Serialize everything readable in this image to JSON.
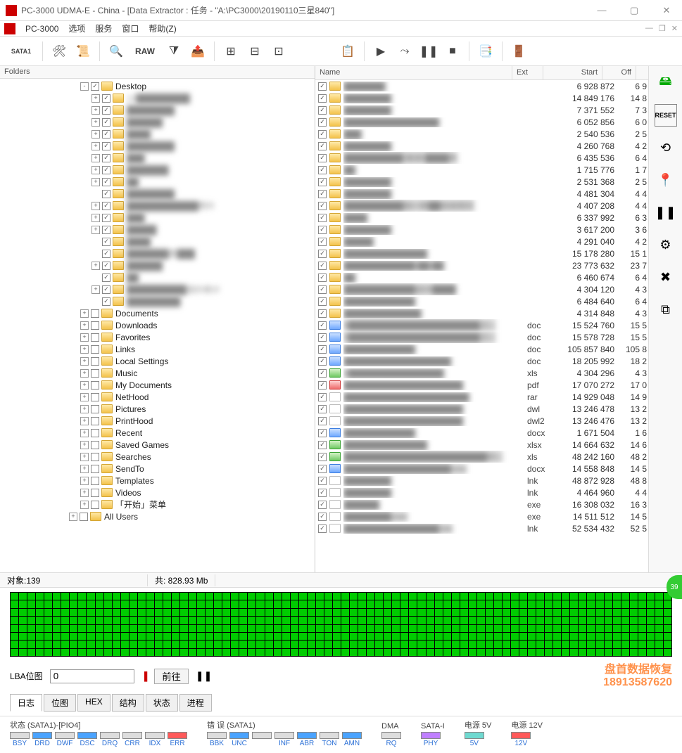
{
  "window": {
    "title": "PC-3000 UDMA-E - China - [Data Extractor : 任务 - \"A:\\PC3000\\20190110三星840\"]",
    "app_name": "PC-3000"
  },
  "menu": {
    "items": [
      "PC-3000",
      "选项",
      "服务",
      "窗口",
      "帮助(Z)"
    ]
  },
  "toolbar": {
    "sata": "SATA1",
    "raw": "RAW"
  },
  "left_panel": {
    "header": "Folders"
  },
  "tree": [
    {
      "indent": 7,
      "exp": "-",
      "chk": true,
      "label": "Desktop"
    },
    {
      "indent": 8,
      "exp": "+",
      "chk": true,
      "label": "12█████████",
      "blur": true
    },
    {
      "indent": 8,
      "exp": "+",
      "chk": true,
      "label": "████████",
      "blur": true
    },
    {
      "indent": 8,
      "exp": "+",
      "chk": true,
      "label": "██████",
      "blur": true
    },
    {
      "indent": 8,
      "exp": "+",
      "chk": true,
      "label": "████",
      "blur": true
    },
    {
      "indent": 8,
      "exp": "+",
      "chk": true,
      "label": "████████",
      "blur": true
    },
    {
      "indent": 8,
      "exp": "+",
      "chk": true,
      "label": "███",
      "blur": true
    },
    {
      "indent": 8,
      "exp": "+",
      "chk": true,
      "label": "███████",
      "blur": true
    },
    {
      "indent": 8,
      "exp": "+",
      "chk": true,
      "label": "██",
      "blur": true
    },
    {
      "indent": 8,
      "exp": "",
      "chk": true,
      "label": "████████",
      "blur": true
    },
    {
      "indent": 8,
      "exp": "+",
      "chk": true,
      "label": "████████████照片",
      "blur": true
    },
    {
      "indent": 8,
      "exp": "+",
      "chk": true,
      "label": "███",
      "blur": true
    },
    {
      "indent": 8,
      "exp": "+",
      "chk": true,
      "label": "█████",
      "blur": true
    },
    {
      "indent": 8,
      "exp": "",
      "chk": true,
      "label": "████",
      "blur": true
    },
    {
      "indent": 8,
      "exp": "",
      "chk": true,
      "label": "███████图███",
      "blur": true
    },
    {
      "indent": 8,
      "exp": "+",
      "chk": true,
      "label": "██████",
      "blur": true
    },
    {
      "indent": 8,
      "exp": "",
      "chk": true,
      "label": "██",
      "blur": true
    },
    {
      "indent": 8,
      "exp": "+",
      "chk": true,
      "label": "██████████造价统计",
      "blur": true
    },
    {
      "indent": 8,
      "exp": "",
      "chk": true,
      "label": "█████████",
      "blur": true
    },
    {
      "indent": 7,
      "exp": "+",
      "chk": false,
      "label": "Documents"
    },
    {
      "indent": 7,
      "exp": "+",
      "chk": false,
      "label": "Downloads"
    },
    {
      "indent": 7,
      "exp": "+",
      "chk": false,
      "label": "Favorites"
    },
    {
      "indent": 7,
      "exp": "+",
      "chk": false,
      "label": "Links"
    },
    {
      "indent": 7,
      "exp": "+",
      "chk": false,
      "label": "Local Settings"
    },
    {
      "indent": 7,
      "exp": "+",
      "chk": false,
      "label": "Music"
    },
    {
      "indent": 7,
      "exp": "+",
      "chk": false,
      "label": "My Documents"
    },
    {
      "indent": 7,
      "exp": "+",
      "chk": false,
      "label": "NetHood"
    },
    {
      "indent": 7,
      "exp": "+",
      "chk": false,
      "label": "Pictures"
    },
    {
      "indent": 7,
      "exp": "+",
      "chk": false,
      "label": "PrintHood"
    },
    {
      "indent": 7,
      "exp": "+",
      "chk": false,
      "label": "Recent"
    },
    {
      "indent": 7,
      "exp": "+",
      "chk": false,
      "label": "Saved Games"
    },
    {
      "indent": 7,
      "exp": "+",
      "chk": false,
      "label": "Searches"
    },
    {
      "indent": 7,
      "exp": "+",
      "chk": false,
      "label": "SendTo"
    },
    {
      "indent": 7,
      "exp": "+",
      "chk": false,
      "label": "Templates"
    },
    {
      "indent": 7,
      "exp": "+",
      "chk": false,
      "label": "Videos"
    },
    {
      "indent": 7,
      "exp": "+",
      "chk": false,
      "label": "「开始」菜单"
    },
    {
      "indent": 6,
      "exp": "+",
      "chk": false,
      "label": "All Users"
    }
  ],
  "filelist": {
    "columns": {
      "name": "Name",
      "ext": "Ext",
      "start": "Start",
      "off": "Off"
    },
    "rows": [
      {
        "chk": true,
        "icon": "folder",
        "name": "███████",
        "ext": "",
        "start": "6 928 872",
        "off": "6 9"
      },
      {
        "chk": true,
        "icon": "folder",
        "name": "████████",
        "ext": "",
        "start": "14 849 176",
        "off": "14 8"
      },
      {
        "chk": true,
        "icon": "folder",
        "name": "████████",
        "ext": "",
        "start": "7 371 552",
        "off": "7 3"
      },
      {
        "chk": true,
        "icon": "folder",
        "name": "████████████████",
        "ext": "",
        "start": "6 052 856",
        "off": "6 0"
      },
      {
        "chk": true,
        "icon": "folder",
        "name": "███",
        "ext": "",
        "start": "2 540 536",
        "off": "2 5"
      },
      {
        "chk": true,
        "icon": "folder",
        "name": "████████",
        "ext": "",
        "start": "4 260 768",
        "off": "4 2"
      },
      {
        "chk": true,
        "icon": "folder",
        "name": "██████████ 案源 ████件",
        "ext": "",
        "start": "6 435 536",
        "off": "6 4"
      },
      {
        "chk": true,
        "icon": "folder",
        "name": "██",
        "ext": "",
        "start": "1 715 776",
        "off": "1 7"
      },
      {
        "chk": true,
        "icon": "folder",
        "name": "████████",
        "ext": "",
        "start": "2 531 368",
        "off": "2 5"
      },
      {
        "chk": true,
        "icon": "folder",
        "name": "████████",
        "ext": "",
        "start": "4 481 304",
        "off": "4 4"
      },
      {
        "chk": true,
        "icon": "folder",
        "name": "██████████园一期██验收照片",
        "ext": "",
        "start": "4 407 208",
        "off": "4 4"
      },
      {
        "chk": true,
        "icon": "folder",
        "name": "████",
        "ext": "",
        "start": "6 337 992",
        "off": "6 3"
      },
      {
        "chk": true,
        "icon": "folder",
        "name": "████████",
        "ext": "",
        "start": "3 617 200",
        "off": "3 6"
      },
      {
        "chk": true,
        "icon": "folder",
        "name": "█████",
        "ext": "",
        "start": "4 291 040",
        "off": "4 2"
      },
      {
        "chk": true,
        "icon": "folder",
        "name": "██████████████",
        "ext": "",
        "start": "15 178 280",
        "off": "15 1"
      },
      {
        "chk": true,
        "icon": "folder",
        "name": "████████████ ██ ██",
        "ext": "",
        "start": "23 773 632",
        "off": "23 7"
      },
      {
        "chk": true,
        "icon": "folder",
        "name": "██",
        "ext": "",
        "start": "6 460 674",
        "off": "6 4"
      },
      {
        "chk": true,
        "icon": "folder",
        "name": "████████████设计████",
        "ext": "",
        "start": "4 304 120",
        "off": "4 3"
      },
      {
        "chk": true,
        "icon": "folder",
        "name": "████████████",
        "ext": "",
        "start": "6 484 640",
        "off": "6 4"
      },
      {
        "chk": true,
        "icon": "folder",
        "name": "█████████████",
        "ext": "",
        "start": "4 314 848",
        "off": "4 3"
      },
      {
        "chk": true,
        "icon": "doc",
        "name": "0██████████████████████之...",
        "ext": "doc",
        "start": "15 524 760",
        "off": "15 5"
      },
      {
        "chk": true,
        "icon": "doc",
        "name": "0██████████████████████之...",
        "ext": "doc",
        "start": "15 578 728",
        "off": "15 5"
      },
      {
        "chk": true,
        "icon": "doc",
        "name": "████████████",
        "ext": "doc",
        "start": "105 857 840",
        "off": "105 8"
      },
      {
        "chk": true,
        "icon": "doc",
        "name": "██████████████████",
        "ext": "doc",
        "start": "18 205 992",
        "off": "18 2"
      },
      {
        "chk": true,
        "icon": "xls",
        "name": "2████████████████",
        "ext": "xls",
        "start": "4 304 296",
        "off": "4 3"
      },
      {
        "chk": true,
        "icon": "pdf",
        "name": "████████████████████",
        "ext": "pdf",
        "start": "17 070 272",
        "off": "17 0"
      },
      {
        "chk": true,
        "icon": "generic",
        "name": "█████████████████████",
        "ext": "rar",
        "start": "14 929 048",
        "off": "14 9"
      },
      {
        "chk": true,
        "icon": "generic",
        "name": "████████████████████",
        "ext": "dwl",
        "start": "13 246 478",
        "off": "13 2"
      },
      {
        "chk": true,
        "icon": "generic",
        "name": "████████████████████",
        "ext": "dwl2",
        "start": "13 246 476",
        "off": "13 2"
      },
      {
        "chk": true,
        "icon": "doc",
        "name": "████████████",
        "ext": "docx",
        "start": "1 671 504",
        "off": "1 6"
      },
      {
        "chk": true,
        "icon": "xls",
        "name": "██████████████",
        "ext": "xlsx",
        "start": "14 664 632",
        "off": "14 6"
      },
      {
        "chk": true,
        "icon": "xls",
        "name": "████████████████████████初...",
        "ext": "xls",
        "start": "48 242 160",
        "off": "48 2"
      },
      {
        "chk": true,
        "icon": "doc",
        "name": "██████████████████.ocx",
        "ext": "docx",
        "start": "14 558 848",
        "off": "14 5"
      },
      {
        "chk": true,
        "icon": "generic",
        "name": "████████",
        "ext": "lnk",
        "start": "48 872 928",
        "off": "48 8"
      },
      {
        "chk": true,
        "icon": "generic",
        "name": "████████",
        "ext": "lnk",
        "start": "4 464 960",
        "off": "4 4"
      },
      {
        "chk": true,
        "icon": "generic",
        "name": "██████",
        "ext": "exe",
        "start": "16 308 032",
        "off": "16 3"
      },
      {
        "chk": true,
        "icon": "generic",
        "name": "████████.exe",
        "ext": "exe",
        "start": "14 511 512",
        "off": "14 5"
      },
      {
        "chk": true,
        "icon": "generic",
        "name": "████████████████.lnk",
        "ext": "lnk",
        "start": "52 534 432",
        "off": "52 5"
      }
    ]
  },
  "statusbar": {
    "objects": "对象:139",
    "total": "共:   828.93 Mb"
  },
  "lba": {
    "label": "LBA位图",
    "value": "0",
    "goto": "前往"
  },
  "watermark": {
    "line1": "盘首数据恢复",
    "line2": "18913587620"
  },
  "tabs": [
    "日志",
    "位图",
    "HEX",
    "结构",
    "状态",
    "进程"
  ],
  "bottom": {
    "group1_label": "状态 (SATA1)-[PIO4]",
    "group1": [
      "BSY",
      "DRD",
      "DWF",
      "DSC",
      "DRQ",
      "CRR",
      "IDX",
      "ERR"
    ],
    "group2_label": "错 误 (SATA1)",
    "group2": [
      "BBK",
      "UNC",
      "",
      "INF",
      "ABR",
      "TON",
      "AMN"
    ],
    "dma_label": "DMA",
    "dma": [
      "RQ"
    ],
    "satai_label": "SATA-I",
    "satai": [
      "PHY"
    ],
    "pwr5_label": "电源 5V",
    "pwr5": [
      "5V"
    ],
    "pwr12_label": "电源 12V",
    "pwr12": [
      "12V"
    ]
  }
}
